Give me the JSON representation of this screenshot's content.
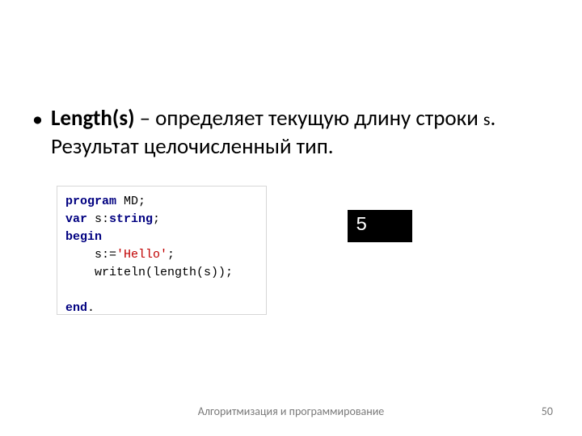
{
  "bullet": {
    "marker": "•",
    "strong": "Length(s)",
    "rest_pre": " – определяет текущую длину строки ",
    "param": "s",
    "rest_post": ". Результат целочисленный тип."
  },
  "code": {
    "l1_kw": "program",
    "l1_id": " MD",
    "l1_p": ";",
    "l2_kw": "var",
    "l2_id": " s:",
    "l2_typ": "string",
    "l2_p": ";",
    "l3_kw": "begin",
    "l4_pre": "    s:=",
    "l4_str": "'Hello'",
    "l4_p": ";",
    "l5_pre": "    writeln(length(s))",
    "l5_p": ";",
    "l6_blank": " ",
    "l7_kw": "end",
    "l7_p": "."
  },
  "output": {
    "value": "5"
  },
  "footer": {
    "text": "Алгоритмизация и программирование",
    "page": "50"
  }
}
